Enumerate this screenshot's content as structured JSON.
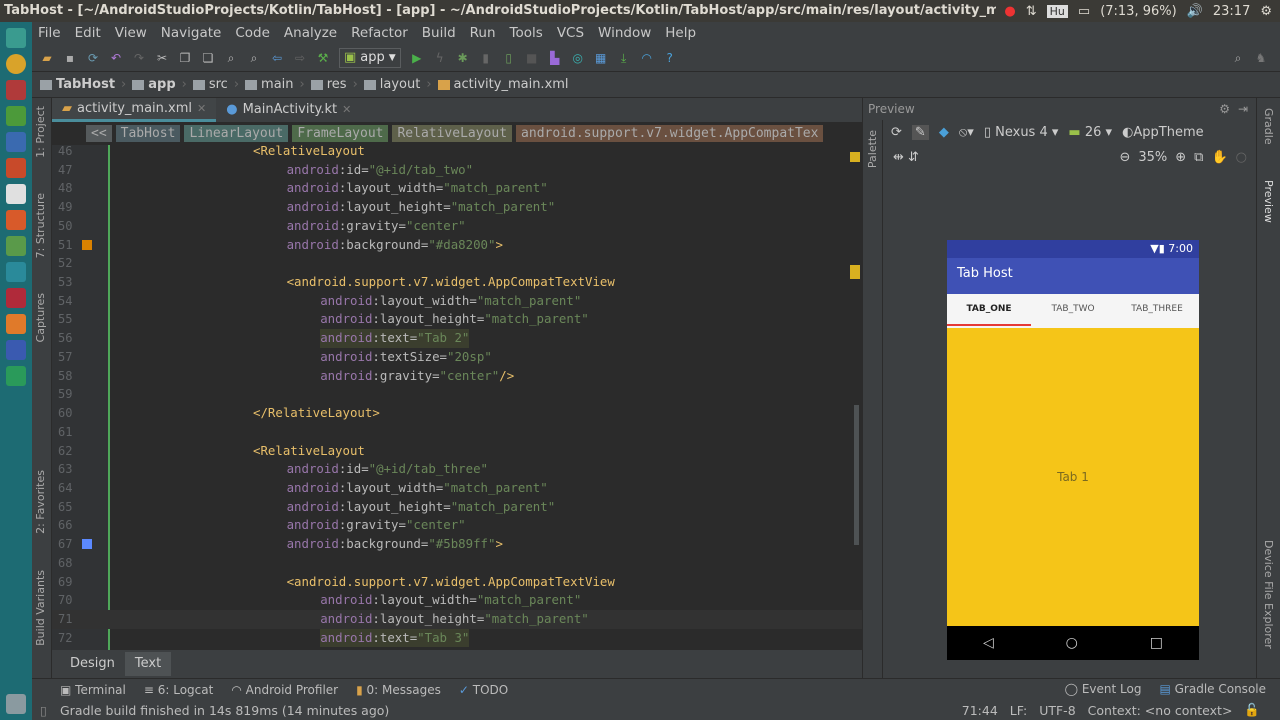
{
  "window": {
    "title": "TabHost - [~/AndroidStudioProjects/Kotlin/TabHost] - [app] - ~/AndroidStudioProjects/Kotlin/TabHost/app/src/main/res/layout/activity_main.x"
  },
  "tray": {
    "battery": "(7:13, 96%)",
    "clock": "23:17",
    "keyboard": "Hu"
  },
  "menu": [
    "File",
    "Edit",
    "View",
    "Navigate",
    "Code",
    "Analyze",
    "Refactor",
    "Build",
    "Run",
    "Tools",
    "VCS",
    "Window",
    "Help"
  ],
  "toolbar": {
    "run_config": "app"
  },
  "nav": [
    "TabHost",
    "app",
    "src",
    "main",
    "res",
    "layout",
    "activity_main.xml"
  ],
  "left_tools": [
    "1: Project",
    "7: Structure",
    "Captures",
    "2: Favorites",
    "Build Variants"
  ],
  "right_tools": [
    "Gradle",
    "Preview",
    "Device File Explorer"
  ],
  "editor_tabs": [
    {
      "label": "activity_main.xml",
      "active": true
    },
    {
      "label": "MainActivity.kt",
      "active": false
    }
  ],
  "xml_breadcrumb": [
    "<<",
    "TabHost",
    "LinearLayout",
    "FrameLayout",
    "RelativeLayout",
    "android.support.v7.widget.AppCompatTex"
  ],
  "code": [
    {
      "n": "46",
      "i": 0,
      "s": [
        [
          "tag",
          "<RelativeLayout"
        ]
      ]
    },
    {
      "n": "47",
      "i": 1,
      "s": [
        [
          "ns",
          "android"
        ],
        [
          "at",
          ":id="
        ],
        [
          "val",
          "\"@+id/tab_two\""
        ]
      ]
    },
    {
      "n": "48",
      "i": 1,
      "s": [
        [
          "ns",
          "android"
        ],
        [
          "at",
          ":layout_width="
        ],
        [
          "val",
          "\"match_parent\""
        ]
      ]
    },
    {
      "n": "49",
      "i": 1,
      "s": [
        [
          "ns",
          "android"
        ],
        [
          "at",
          ":layout_height="
        ],
        [
          "val",
          "\"match_parent\""
        ]
      ]
    },
    {
      "n": "50",
      "i": 1,
      "s": [
        [
          "ns",
          "android"
        ],
        [
          "at",
          ":gravity="
        ],
        [
          "val",
          "\"center\""
        ]
      ]
    },
    {
      "n": "51",
      "i": 1,
      "s": [
        [
          "ns",
          "android"
        ],
        [
          "at",
          ":background="
        ],
        [
          "val",
          "\"#da8200\""
        ],
        [
          "tag",
          ">"
        ]
      ],
      "mark": "#da8200"
    },
    {
      "n": "52",
      "i": 0,
      "s": []
    },
    {
      "n": "53",
      "i": 1,
      "s": [
        [
          "tag",
          "<android.support.v7.widget.AppCompatTextView"
        ]
      ]
    },
    {
      "n": "54",
      "i": 2,
      "s": [
        [
          "ns",
          "android"
        ],
        [
          "at",
          ":layout_width="
        ],
        [
          "val",
          "\"match_parent\""
        ]
      ]
    },
    {
      "n": "55",
      "i": 2,
      "s": [
        [
          "ns",
          "android"
        ],
        [
          "at",
          ":layout_height="
        ],
        [
          "val",
          "\"match_parent\""
        ]
      ]
    },
    {
      "n": "56",
      "i": 2,
      "s": [
        [
          "ns",
          "android"
        ],
        [
          "at",
          ":text="
        ],
        [
          "val",
          "\"Tab 2\""
        ]
      ],
      "hl": true
    },
    {
      "n": "57",
      "i": 2,
      "s": [
        [
          "ns",
          "android"
        ],
        [
          "at",
          ":textSize="
        ],
        [
          "val",
          "\"20sp\""
        ]
      ]
    },
    {
      "n": "58",
      "i": 2,
      "s": [
        [
          "ns",
          "android"
        ],
        [
          "at",
          ":gravity="
        ],
        [
          "val",
          "\"center\""
        ],
        [
          "tag",
          "/>"
        ]
      ]
    },
    {
      "n": "59",
      "i": 0,
      "s": []
    },
    {
      "n": "60",
      "i": 0,
      "s": [
        [
          "tag",
          "</RelativeLayout>"
        ]
      ]
    },
    {
      "n": "61",
      "i": 0,
      "s": []
    },
    {
      "n": "62",
      "i": 0,
      "s": [
        [
          "tag",
          "<RelativeLayout"
        ]
      ]
    },
    {
      "n": "63",
      "i": 1,
      "s": [
        [
          "ns",
          "android"
        ],
        [
          "at",
          ":id="
        ],
        [
          "val",
          "\"@+id/tab_three\""
        ]
      ]
    },
    {
      "n": "64",
      "i": 1,
      "s": [
        [
          "ns",
          "android"
        ],
        [
          "at",
          ":layout_width="
        ],
        [
          "val",
          "\"match_parent\""
        ]
      ]
    },
    {
      "n": "65",
      "i": 1,
      "s": [
        [
          "ns",
          "android"
        ],
        [
          "at",
          ":layout_height="
        ],
        [
          "val",
          "\"match_parent\""
        ]
      ]
    },
    {
      "n": "66",
      "i": 1,
      "s": [
        [
          "ns",
          "android"
        ],
        [
          "at",
          ":gravity="
        ],
        [
          "val",
          "\"center\""
        ]
      ]
    },
    {
      "n": "67",
      "i": 1,
      "s": [
        [
          "ns",
          "android"
        ],
        [
          "at",
          ":background="
        ],
        [
          "val",
          "\"#5b89ff\""
        ],
        [
          "tag",
          ">"
        ]
      ],
      "mark": "#5b89ff"
    },
    {
      "n": "68",
      "i": 0,
      "s": []
    },
    {
      "n": "69",
      "i": 1,
      "s": [
        [
          "tag",
          "<android.support.v7.widget.AppCompatTextView"
        ]
      ]
    },
    {
      "n": "70",
      "i": 2,
      "s": [
        [
          "ns",
          "android"
        ],
        [
          "at",
          ":layout_width="
        ],
        [
          "val",
          "\"match_parent\""
        ]
      ]
    },
    {
      "n": "71",
      "i": 2,
      "s": [
        [
          "ns",
          "android"
        ],
        [
          "at",
          ":layout_height="
        ],
        [
          "val",
          "\"match_parent\""
        ]
      ]
    },
    {
      "n": "72",
      "i": 2,
      "s": [
        [
          "ns",
          "android"
        ],
        [
          "at",
          ":text="
        ],
        [
          "val",
          "\"Tab 3\""
        ]
      ],
      "hl": true
    }
  ],
  "design_tabs": [
    "Design",
    "Text"
  ],
  "preview": {
    "title": "Preview",
    "palette": "Palette",
    "device": "Nexus 4",
    "api": "26",
    "theme": "AppTheme",
    "zoom": "35%",
    "phone": {
      "time": "7:00",
      "app_title": "Tab Host",
      "tabs": [
        "TAB_ONE",
        "TAB_TWO",
        "TAB_THREE"
      ],
      "selected_tab": 0,
      "content": "Tab 1",
      "bg": "#f5c518"
    }
  },
  "bottom_tools": [
    "Terminal",
    "6: Logcat",
    "Android Profiler",
    "0: Messages",
    "TODO"
  ],
  "bottom_right_tools": [
    "Event Log",
    "Gradle Console"
  ],
  "status": {
    "message": "Gradle build finished in 14s 819ms (14 minutes ago)",
    "position": "71:44",
    "line_sep": "LF:",
    "encoding": "UTF-8",
    "context": "Context: <no context>"
  }
}
